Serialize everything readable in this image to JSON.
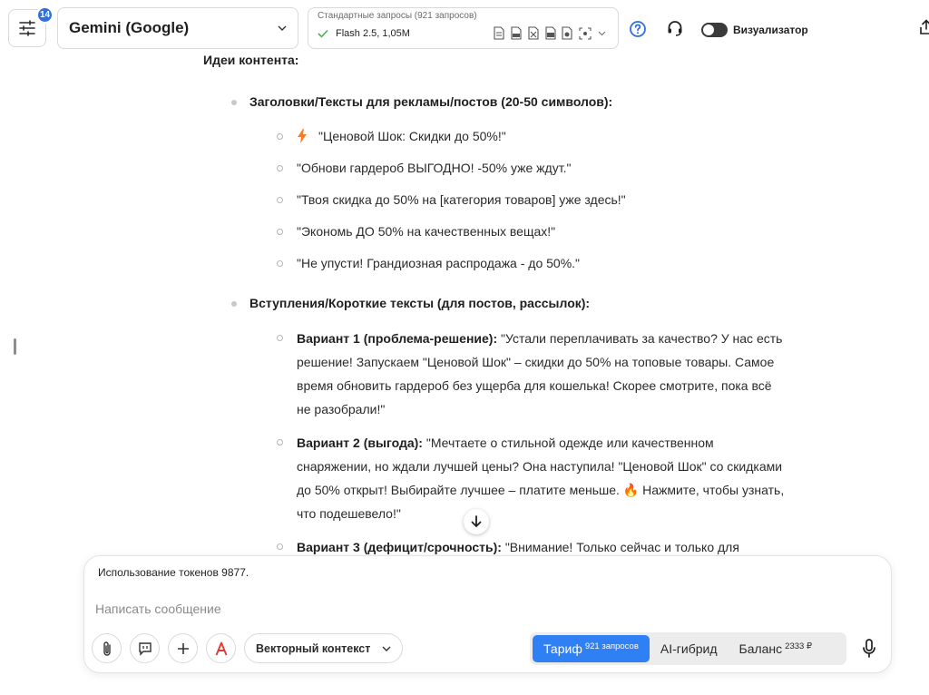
{
  "header": {
    "settings_badge": "14",
    "model_name": "Gemini (Google)",
    "mode_title": "Стандартные запросы (921 запросов)",
    "mode_model": "Flash 2.5, 1,05M",
    "visualizer_label": "Визуализатор",
    "visualizer_on": true
  },
  "content": {
    "heading": "Идеи контента:",
    "section1_title": "Заголовки/Тексты для рекламы/постов (20-50 символов):",
    "section1_items": [
      "\"Ценовой Шок: Скидки до 50%!\"",
      "\"Обнови гардероб ВЫГОДНО! -50% уже ждут.\"",
      "\"Твоя скидка до 50% на [категория товаров] уже здесь!\"",
      "\"Экономь ДО 50% на качественных вещах!\"",
      "\"Не упусти! Грандиозная распродажа - до 50%.\""
    ],
    "section2_title": "Вступления/Короткие тексты (для постов, рассылок):",
    "variants": [
      {
        "label": "Вариант 1 (проблема-решение):",
        "text": " \"Устали переплачивать за качество? У нас есть решение! Запускаем \"Ценовой Шок\" – скидки до 50% на топовые товары. Самое время обновить гардероб без ущерба для кошелька! Скорее смотрите, пока всё не разобрали!\""
      },
      {
        "label": "Вариант 2 (выгода):",
        "text": " \"Мечтаете о стильной одежде или качественном снаряжении, но ждали лучшей цены? Она наступила! \"Ценовой Шок\" со скидками до 50% открыт! Выбирайте лучшее – платите меньше. 🔥 Нажмите, чтобы узнать, что подешевело!\""
      },
      {
        "label": "Вариант 3 (дефицит/срочность):",
        "text": " \"Внимание! Только сейчас и только для"
      }
    ]
  },
  "composer": {
    "token_usage": "Использование токенов 9877.",
    "placeholder": "Написать сообщение",
    "context_label": "Векторный контекст",
    "plan_tabs": [
      {
        "label": "Тариф",
        "sup": "921 запросов",
        "active": true
      },
      {
        "label": "AI-гибрид",
        "sup": "",
        "active": false
      },
      {
        "label": "Баланс",
        "sup": "2333 ₽",
        "active": false
      }
    ]
  },
  "colors": {
    "accent": "#2f7ff5",
    "badge": "#2f6fde",
    "check": "#4caf50",
    "lightning": "#f57c2a",
    "red_letter": "#e53935"
  }
}
